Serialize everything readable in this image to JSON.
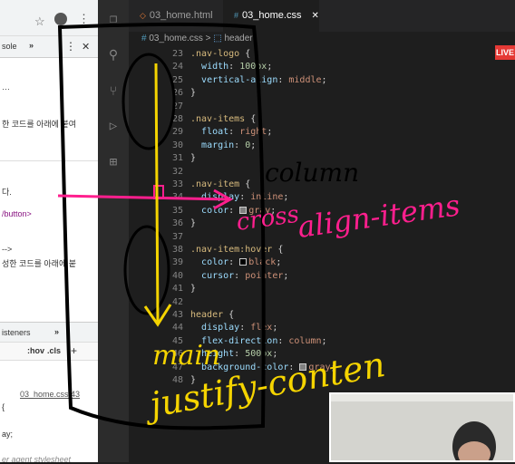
{
  "devtools": {
    "tab_console": "sole",
    "more": "»",
    "close": "✕",
    "lines": [
      {
        "text": "…",
        "cls": ""
      },
      {
        "text": "한 코드를 아래에 붙여",
        "cls": ""
      },
      {
        "text": "다.",
        "cls": ""
      },
      {
        "text": "/button>",
        "cls": "dt-blue"
      },
      {
        "text": "-->",
        "cls": ""
      },
      {
        "text": "성한 코드를 아래에 붙",
        "cls": ""
      }
    ],
    "bottom": {
      "listeners": "isteners",
      "more": "»",
      "hov": ":hov",
      "cls": ".cls",
      "plus": "+",
      "file_link": "03_home.css:43",
      "brace": "{",
      "ay": "ay;",
      "user_agent": "er agent stylesheet"
    }
  },
  "tabs": [
    {
      "label": "03_home.html",
      "active": false,
      "icon": "◇"
    },
    {
      "label": "03_home.css",
      "active": true,
      "icon": "#"
    }
  ],
  "tab_close": "✕",
  "breadcrumb": {
    "file": "03_home.css",
    "sep": ">",
    "symbol": "header"
  },
  "live_badge": "LIVE",
  "code_lines": [
    {
      "n": "23",
      "html": "<span class='sel'>.nav-logo</span> {"
    },
    {
      "n": "24",
      "html": "  <span class='prop'>width</span>: <span class='num'>100px</span>;"
    },
    {
      "n": "25",
      "html": "  <span class='prop'>vertical-align</span>: <span class='val'>middle</span>;"
    },
    {
      "n": "26",
      "html": "}"
    },
    {
      "n": "27",
      "html": ""
    },
    {
      "n": "28",
      "html": "<span class='sel'>.nav-items</span> {"
    },
    {
      "n": "29",
      "html": "  <span class='prop'>float</span>: <span class='val'>right</span>;"
    },
    {
      "n": "30",
      "html": "  <span class='prop'>margin</span>: <span class='num'>0</span>;"
    },
    {
      "n": "31",
      "html": "}"
    },
    {
      "n": "32",
      "html": ""
    },
    {
      "n": "33",
      "html": "<span class='sel'>.nav-item</span> {"
    },
    {
      "n": "34",
      "html": "  <span class='prop'>display</span>: <span class='val'>inline</span>;"
    },
    {
      "n": "35",
      "html": "  <span class='prop'>color</span>: <span class='sw' style='background:#808080'></span><span class='val'>gray</span>;"
    },
    {
      "n": "36",
      "html": "}"
    },
    {
      "n": "37",
      "html": ""
    },
    {
      "n": "38",
      "html": "<span class='sel'>.nav-item:hover</span> {"
    },
    {
      "n": "39",
      "html": "  <span class='prop'>color</span>: <span class='sw' style='background:#000'></span><span class='val'>black</span>;"
    },
    {
      "n": "40",
      "html": "  <span class='prop'>cursor</span>: <span class='val'>pointer</span>;"
    },
    {
      "n": "41",
      "html": "}"
    },
    {
      "n": "42",
      "html": ""
    },
    {
      "n": "43",
      "html": "<span class='sel'>header</span> {"
    },
    {
      "n": "44",
      "html": "  <span class='prop'>display</span>: <span class='val'>flex</span>;"
    },
    {
      "n": "45",
      "html": "  <span class='prop'>flex-direction</span>: <span class='val'>column</span>;"
    },
    {
      "n": "46",
      "html": "  <span class='prop'>height</span>: <span class='num'>500px</span>;"
    },
    {
      "n": "47",
      "html": "  <span class='prop'>background-color</span>: <span class='sw' style='background:#808080'></span><span class='val'>gray</span>;"
    },
    {
      "n": "48",
      "html": "}"
    }
  ],
  "annotations": {
    "column": "column",
    "cross": "cross",
    "align_items": "align-items",
    "main": "main",
    "justify_content": "justify-conten"
  },
  "colors": {
    "pink": "#ff1f8e",
    "yellow": "#f5d400",
    "ink": "#000000"
  }
}
